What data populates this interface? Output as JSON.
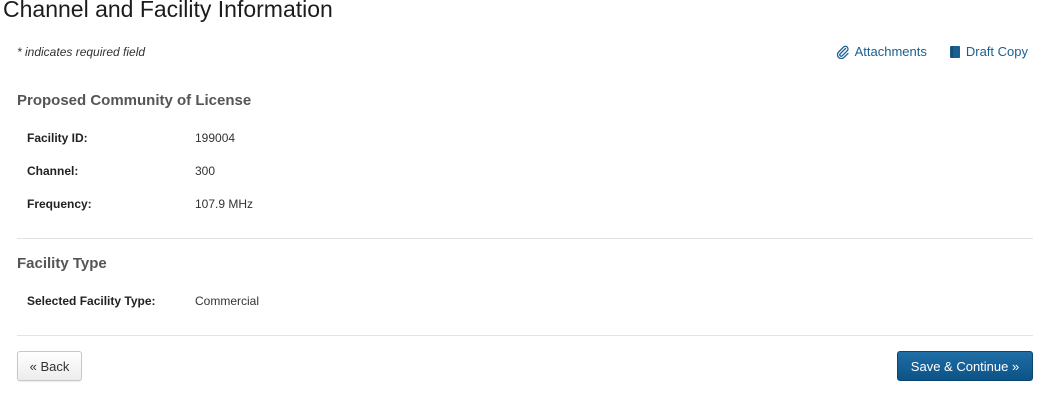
{
  "header": {
    "title": "Channel and Facility Information",
    "required_note": "* indicates required field"
  },
  "links": {
    "attachments": "Attachments",
    "draft_copy": "Draft Copy"
  },
  "community_section": {
    "title": "Proposed Community of License",
    "fields": [
      {
        "label": "Facility ID:",
        "value": "199004"
      },
      {
        "label": "Channel:",
        "value": "300"
      },
      {
        "label": "Frequency:",
        "value": "107.9 MHz"
      }
    ]
  },
  "facility_type_section": {
    "title": "Facility Type",
    "fields": [
      {
        "label": "Selected Facility Type:",
        "value": "Commercial"
      }
    ]
  },
  "buttons": {
    "back": "« Back",
    "save_continue": "Save & Continue »"
  },
  "colors": {
    "link": "#1a5f8f",
    "primary_button": "#0c5386"
  }
}
